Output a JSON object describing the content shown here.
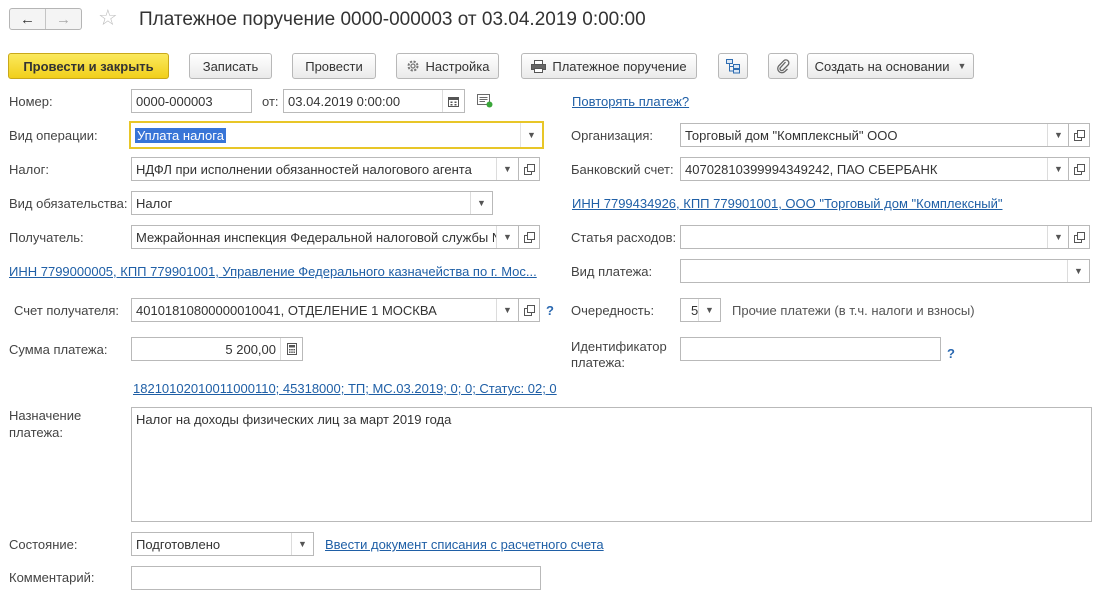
{
  "title": "Платежное поручение 0000-000003 от 03.04.2019 0:00:00",
  "nav": {
    "back": "←",
    "forward": "→"
  },
  "toolbar": {
    "post_close": "Провести и закрыть",
    "save": "Записать",
    "post": "Провести",
    "settings": "Настройка",
    "payment_order": "Платежное поручение",
    "create_based": "Создать на основании"
  },
  "form": {
    "number_label": "Номер:",
    "number_value": "0000-000003",
    "date_label": "от:",
    "date_value": "03.04.2019  0:00:00",
    "repeat_link": "Повторять платеж?",
    "op_type_label": "Вид операции:",
    "op_type_value": "Уплата налога",
    "org_label": "Организация:",
    "org_value": "Торговый дом \"Комплексный\" ООО",
    "tax_label": "Налог:",
    "tax_value": "НДФЛ при исполнении обязанностей налогового агента",
    "bank_label": "Банковский счет:",
    "bank_value": "40702810399994349242, ПАО СБЕРБАНК",
    "oblig_label": "Вид обязательства:",
    "oblig_value": "Налог",
    "org_inn_link": "ИНН 7799434926, КПП 779901001, ООО \"Торговый дом \"Комплексный\"",
    "recipient_label": "Получатель:",
    "recipient_value": "Межрайонная инспекция Федеральной налоговой службы №",
    "expense_label": "Статья расходов:",
    "expense_value": "",
    "rec_inn_link": "ИНН 7799000005, КПП 779901001, Управление Федерального казначейства по г. Мос...",
    "pay_kind_label": "Вид платежа:",
    "pay_kind_value": "",
    "rec_account_label": "Счет получателя:",
    "rec_account_value": "40101810800000010041, ОТДЕЛЕНИЕ 1 МОСКВА",
    "priority_label": "Очередность:",
    "priority_value": "5",
    "priority_desc": "Прочие платежи (в т.ч. налоги и взносы)",
    "amount_label": "Сумма платежа:",
    "amount_value": "5 200,00",
    "pay_id_label_1": "Идентификатор",
    "pay_id_label_2": "платежа:",
    "pay_id_value": "",
    "kbk_link": "18210102010011000110; 45318000; ТП; МС.03.2019; 0; 0; Статус: 02; 0",
    "purpose_label_1": "Назначение",
    "purpose_label_2": "платежа:",
    "purpose_value": "Налог на доходы физических лиц за март 2019 года",
    "state_label": "Состояние:",
    "state_value": "Подготовлено",
    "writeoff_link": "Ввести документ списания с расчетного счета",
    "comment_label": "Комментарий:",
    "comment_value": "",
    "help": "?"
  },
  "colors": {
    "primary": "#f5d728",
    "link": "#1f5fa6",
    "focus": "#e8c628",
    "selection": "#3875d7"
  }
}
